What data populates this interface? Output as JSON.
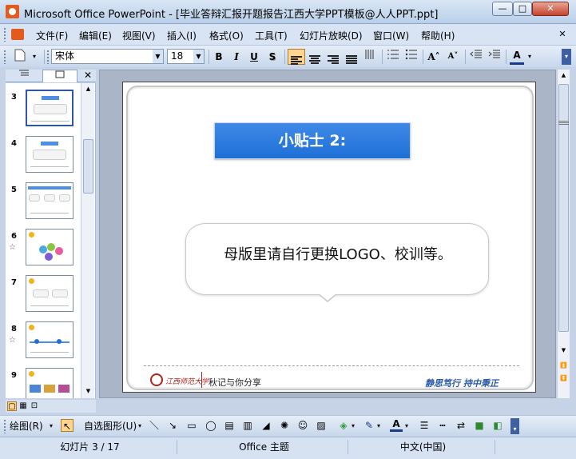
{
  "window": {
    "title": "Microsoft Office PowerPoint - [毕业答辩汇报开题报告江西大学PPT模板@人人PPT.ppt]",
    "min_icon": "minimize-icon",
    "max_icon": "maximize-icon",
    "close_icon": "close-icon",
    "min_glyph": "—",
    "max_glyph": "□",
    "close_glyph": "✕"
  },
  "menu": {
    "items": [
      "文件(F)",
      "编辑(E)",
      "视图(V)",
      "插入(I)",
      "格式(O)",
      "工具(T)",
      "幻灯片放映(D)",
      "窗口(W)",
      "帮助(H)"
    ],
    "close_glyph": "✕"
  },
  "format_toolbar": {
    "font_name": "宋体",
    "font_size": "18",
    "bold": "B",
    "italic": "I",
    "underline": "U",
    "shadow": "S",
    "increase_font": "A˄",
    "decrease_font": "A˅",
    "font_color": "A",
    "colors": {
      "font_color": "#1c3a8a",
      "active_button": "#ffd590"
    }
  },
  "slide_pane": {
    "tab_outline_icon": "outline-icon",
    "tab_slides_icon": "slides-icon",
    "close_glyph": "✕",
    "thumbnails": [
      {
        "number": "3",
        "star": false
      },
      {
        "number": "4",
        "star": false
      },
      {
        "number": "5",
        "star": false
      },
      {
        "number": "6",
        "star": true
      },
      {
        "number": "7",
        "star": false
      },
      {
        "number": "8",
        "star": true
      },
      {
        "number": "9",
        "star": false
      }
    ],
    "selected_index": 0,
    "star_glyph": "☆"
  },
  "slide": {
    "title": "小贴士 2:",
    "bubble_text": "母版里请自行更换LOGO、校训等。",
    "logo_text": "江西师范大学",
    "footer_text": "秋记与你分享",
    "motto": "静思笃行  持中秉正",
    "colors": {
      "title_bar": "#1e6fd6",
      "footer_accent": "#b2231c",
      "motto": "#2a5aa8"
    }
  },
  "drawing_toolbar": {
    "draw_label": "绘图(R)",
    "autoshapes_label": "自选图形(U)"
  },
  "status": {
    "slide_info": "幻灯片 3 / 17",
    "theme": "Office 主题",
    "language": "中文(中国)"
  }
}
